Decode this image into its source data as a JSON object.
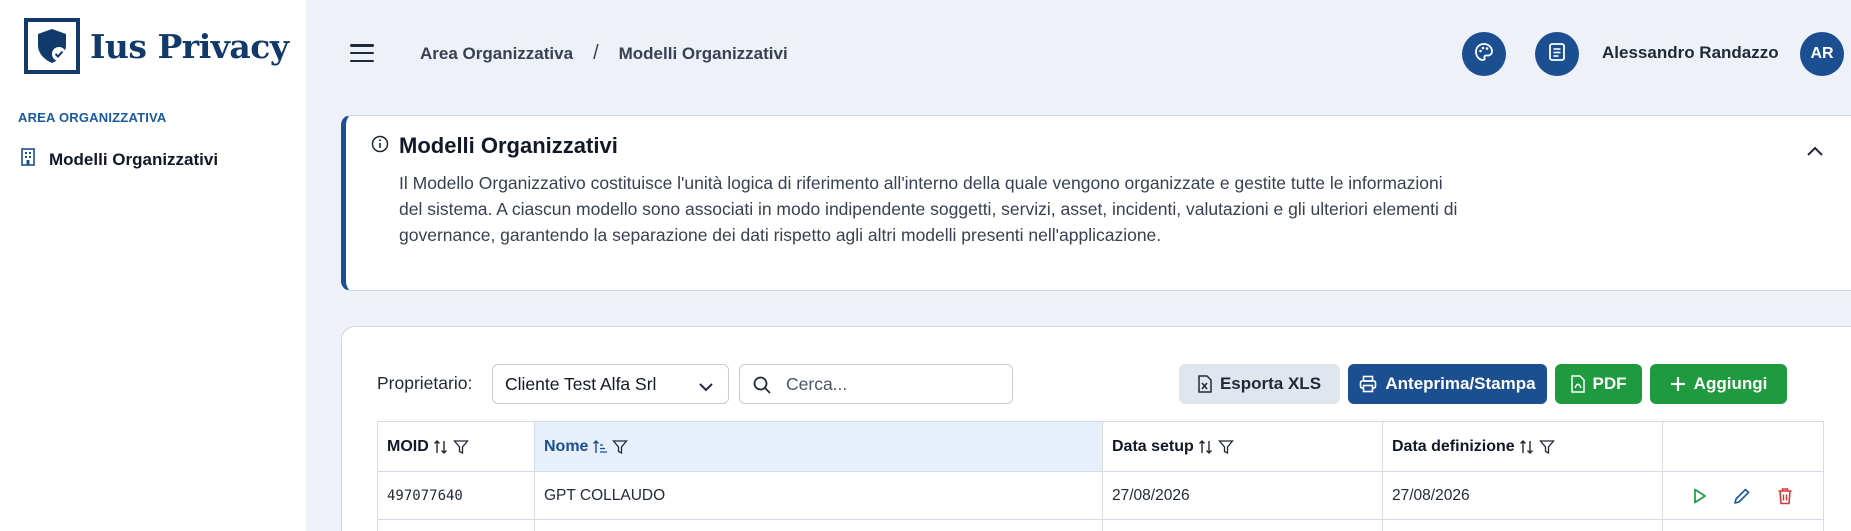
{
  "app": {
    "name": "Ius Privacy"
  },
  "colors": {
    "primary": "#1b4f92",
    "success": "#1f9a3e",
    "danger": "#d23b3b",
    "accent_text": "#1b5aa0"
  },
  "sidebar": {
    "section_title": "AREA ORGANIZZATIVA",
    "items": [
      {
        "label": "Modelli Organizzativi",
        "icon": "building-icon"
      }
    ]
  },
  "header": {
    "breadcrumb": [
      "Area Organizzativa",
      "Modelli Organizzativi"
    ],
    "separator": "/",
    "user": {
      "name": "Alessandro Randazzo",
      "initials": "AR"
    }
  },
  "info": {
    "title": "Modelli Organizzativi",
    "description": "Il Modello Organizzativo costituisce l'unità logica di riferimento all'interno della quale vengono organizzate e gestite tutte le informazioni del sistema. A ciascun modello sono associati in modo indipendente soggetti, servizi, asset, incidenti, valutazioni e gli ulteriori elementi di governance, garantendo la separazione dei dati rispetto agli altri modelli presenti nell'applicazione."
  },
  "toolbar": {
    "owner_label": "Proprietario:",
    "owner_value": "Cliente Test Alfa Srl",
    "search_placeholder": "Cerca...",
    "export_xls_label": "Esporta XLS",
    "print_label": "Anteprima/Stampa",
    "pdf_label": "PDF",
    "add_label": "Aggiungi"
  },
  "table": {
    "columns": [
      "MOID",
      "Nome",
      "Data setup",
      "Data definizione",
      ""
    ],
    "sorted_column": "Nome",
    "rows": [
      {
        "moid": "497077640",
        "nome": "GPT COLLAUDO",
        "data_setup": "27/08/2026",
        "data_definizione": "27/08/2026"
      }
    ]
  }
}
